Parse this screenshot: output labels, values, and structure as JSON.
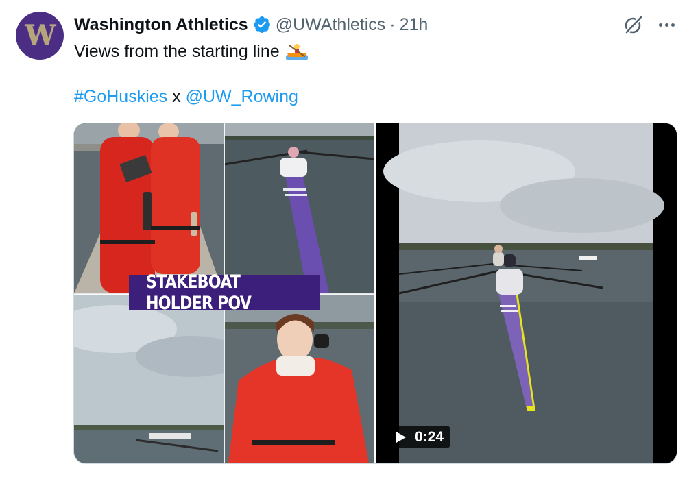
{
  "tweet": {
    "avatar_letter": "W",
    "display_name": "Washington Athletics",
    "handle": "@UWAthletics",
    "separator": "·",
    "time": "21h",
    "text_line1": "Views from the starting line",
    "hashtag": "#GoHuskies",
    "connector": "x",
    "mention": "@UW_Rowing",
    "collage_caption": "STAKEBOAT HOLDER POV",
    "video_duration": "0:24"
  },
  "colors": {
    "uw_purple": "#4b2e83",
    "uw_gold": "#b7a57a",
    "link_blue": "#1d9bf0",
    "verified_blue": "#1d9bf0",
    "muted_text": "#536471"
  },
  "icons": {
    "verified": "verified-badge-icon",
    "grok": "grok-icon",
    "more": "more-options-icon",
    "play": "play-icon",
    "emoji": "rowing-boat-emoji"
  }
}
